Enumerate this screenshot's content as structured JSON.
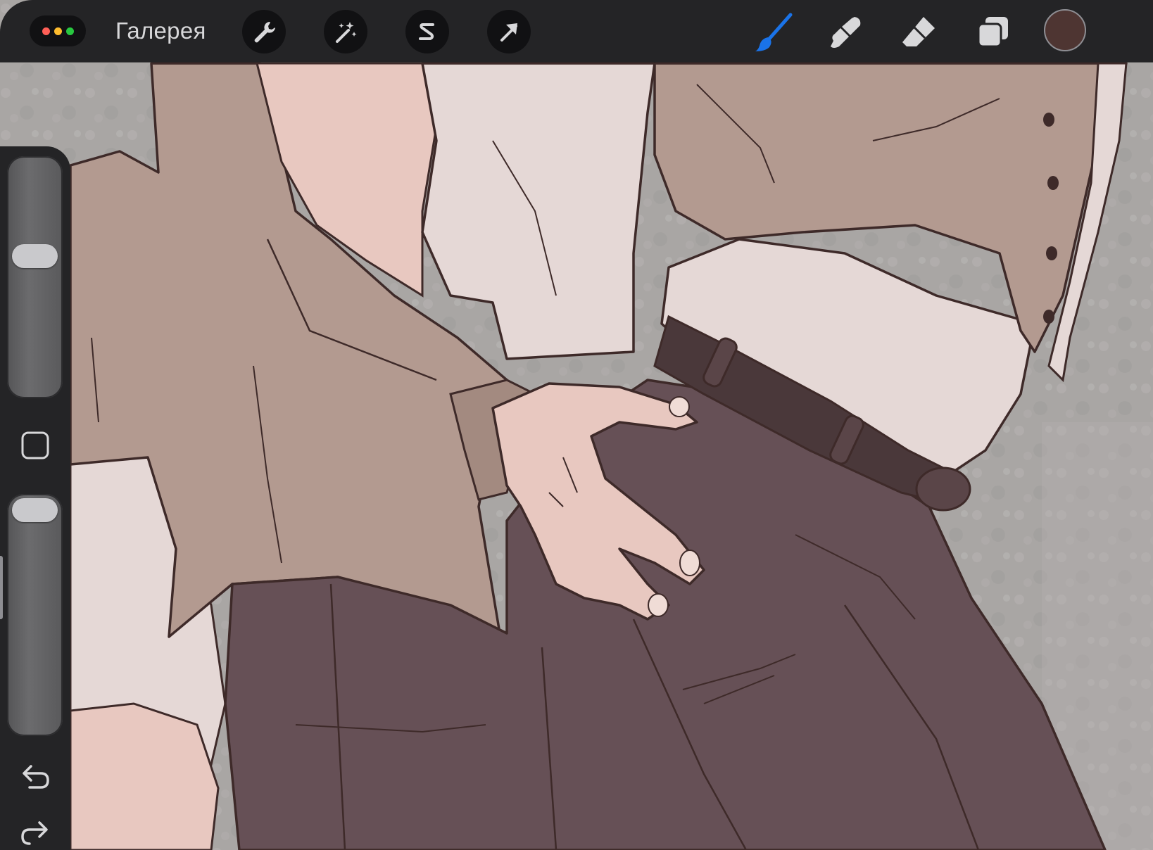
{
  "toolbar": {
    "gallery_label": "Галерея",
    "window_dots": {
      "colors": [
        "#ff5f57",
        "#febc2e",
        "#28c840"
      ]
    },
    "left_tools": [
      {
        "name": "actions",
        "icon": "wrench-icon"
      },
      {
        "name": "adjustments",
        "icon": "magic-wand-icon"
      },
      {
        "name": "selection",
        "icon": "selection-s-icon"
      },
      {
        "name": "transform",
        "icon": "arrow-cursor-icon"
      }
    ],
    "right_tools": [
      {
        "name": "brush",
        "icon": "brush-icon",
        "active": true
      },
      {
        "name": "smudge",
        "icon": "smudge-icon",
        "active": false
      },
      {
        "name": "eraser",
        "icon": "eraser-icon",
        "active": false
      },
      {
        "name": "layers",
        "icon": "layers-icon",
        "active": false
      }
    ],
    "current_color": "#4e3532",
    "active_tool_color": "#1a73e8",
    "icon_color": "#d8d8da"
  },
  "sidebar": {
    "brush_size_level": 0.6,
    "brush_opacity_level": 1.0,
    "modify_icon": "square-modify-icon",
    "undo_icon": "undo-icon",
    "redo_icon": "redo-icon"
  },
  "artwork": {
    "background_color": "#a8a5a3",
    "jacket_color": "#b39a90",
    "shirt_color": "#e5d8d6",
    "skin_color": "#e8c8c0",
    "pants_color": "#665056",
    "belt_color": "#4a383a",
    "line_color": "#3e2a29"
  }
}
